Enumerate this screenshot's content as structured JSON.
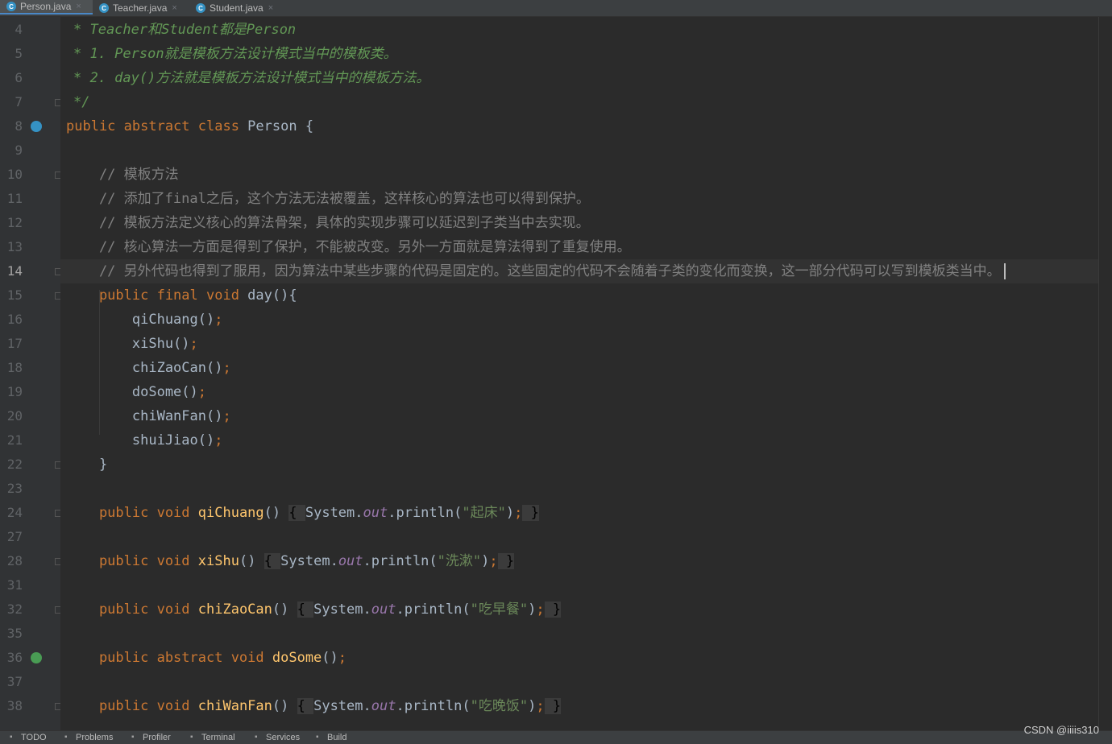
{
  "tabs": [
    {
      "label": "Person.java",
      "active": true,
      "icon": "class-icon"
    },
    {
      "label": "Teacher.java",
      "active": false,
      "icon": "class-icon"
    },
    {
      "label": "Student.java",
      "active": false,
      "icon": "class-icon"
    }
  ],
  "tab_icon_letter": "C",
  "lines": [
    {
      "num": "4",
      "parts": [
        [
          "doc",
          "* Teacher和Student都是Person"
        ]
      ]
    },
    {
      "num": "5",
      "parts": [
        [
          "doc",
          "* 1. Person就是模板方法设计模式当中的模板类。"
        ]
      ]
    },
    {
      "num": "6",
      "parts": [
        [
          "doc",
          "* 2. day()方法就是模板方法设计模式当中的模板方法。"
        ]
      ]
    },
    {
      "num": "7",
      "parts": [
        [
          "doc",
          "*/"
        ]
      ]
    },
    {
      "num": "8",
      "parts": [
        [
          "kw",
          "public abstract class "
        ],
        [
          "pl",
          "Person {"
        ]
      ]
    },
    {
      "num": "9",
      "parts": []
    },
    {
      "num": "10",
      "parts": [
        [
          "cm",
          "    // 模板方法"
        ]
      ]
    },
    {
      "num": "11",
      "parts": [
        [
          "cm",
          "    // 添加了final之后，这个方法无法被覆盖，这样核心的算法也可以得到保护。"
        ]
      ]
    },
    {
      "num": "12",
      "parts": [
        [
          "cm",
          "    // 模板方法定义核心的算法骨架，具体的实现步骤可以延迟到子类当中去实现。"
        ]
      ]
    },
    {
      "num": "13",
      "parts": [
        [
          "cm",
          "    // 核心算法一方面是得到了保护，不能被改变。另外一方面就是算法得到了重复使用。"
        ]
      ]
    },
    {
      "num": "14",
      "parts": [
        [
          "cm",
          "    // 另外代码也得到了服用，因为算法中某些步骤的代码是固定的。这些固定的代码不会随着子类的变化而变换，这一部分代码可以写到模板类当中。"
        ]
      ]
    },
    {
      "num": "15",
      "parts": [
        [
          "kw",
          "    public final void "
        ],
        [
          "pl",
          "day(){"
        ]
      ]
    },
    {
      "num": "16",
      "parts": [
        [
          "pl",
          "        qiChuang()"
        ],
        [
          "kw",
          ";"
        ]
      ]
    },
    {
      "num": "17",
      "parts": [
        [
          "pl",
          "        xiShu()"
        ],
        [
          "kw",
          ";"
        ]
      ]
    },
    {
      "num": "18",
      "parts": [
        [
          "pl",
          "        chiZaoCan()"
        ],
        [
          "kw",
          ";"
        ]
      ]
    },
    {
      "num": "19",
      "parts": [
        [
          "pl",
          "        doSome()"
        ],
        [
          "kw",
          ";"
        ]
      ]
    },
    {
      "num": "20",
      "parts": [
        [
          "pl",
          "        chiWanFan()"
        ],
        [
          "kw",
          ";"
        ]
      ]
    },
    {
      "num": "21",
      "parts": [
        [
          "pl",
          "        shuiJiao()"
        ],
        [
          "kw",
          ";"
        ]
      ]
    },
    {
      "num": "22",
      "parts": [
        [
          "pl",
          "    }"
        ]
      ]
    },
    {
      "num": "23",
      "parts": []
    },
    {
      "num": "24",
      "parts": [
        [
          "kw",
          "    public void "
        ],
        [
          "fn",
          "qiChuang"
        ],
        [
          "pl",
          "() "
        ],
        [
          "box",
          "{ "
        ],
        [
          "pl",
          "System."
        ],
        [
          "fld",
          "out"
        ],
        [
          "pl",
          ".println("
        ],
        [
          "str",
          "\"起床\""
        ],
        [
          "pl",
          ")"
        ],
        [
          "kw",
          ";"
        ],
        [
          "box",
          " }"
        ]
      ]
    },
    {
      "num": "27",
      "parts": []
    },
    {
      "num": "28",
      "parts": [
        [
          "kw",
          "    public void "
        ],
        [
          "fn",
          "xiShu"
        ],
        [
          "pl",
          "() "
        ],
        [
          "box",
          "{ "
        ],
        [
          "pl",
          "System."
        ],
        [
          "fld",
          "out"
        ],
        [
          "pl",
          ".println("
        ],
        [
          "str",
          "\"洗漱\""
        ],
        [
          "pl",
          ")"
        ],
        [
          "kw",
          ";"
        ],
        [
          "box",
          " }"
        ]
      ]
    },
    {
      "num": "31",
      "parts": []
    },
    {
      "num": "32",
      "parts": [
        [
          "kw",
          "    public void "
        ],
        [
          "fn",
          "chiZaoCan"
        ],
        [
          "pl",
          "() "
        ],
        [
          "box",
          "{ "
        ],
        [
          "pl",
          "System."
        ],
        [
          "fld",
          "out"
        ],
        [
          "pl",
          ".println("
        ],
        [
          "str",
          "\"吃早餐\""
        ],
        [
          "pl",
          ")"
        ],
        [
          "kw",
          ";"
        ],
        [
          "box",
          " }"
        ]
      ]
    },
    {
      "num": "35",
      "parts": []
    },
    {
      "num": "36",
      "parts": [
        [
          "kw",
          "    public abstract void "
        ],
        [
          "fn",
          "doSome"
        ],
        [
          "pl",
          "()"
        ],
        [
          "kw",
          ";"
        ]
      ]
    },
    {
      "num": "37",
      "parts": []
    },
    {
      "num": "38",
      "parts": [
        [
          "kw",
          "    public void "
        ],
        [
          "fn",
          "chiWanFan"
        ],
        [
          "pl",
          "() "
        ],
        [
          "box",
          "{ "
        ],
        [
          "pl",
          "System."
        ],
        [
          "fld",
          "out"
        ],
        [
          "pl",
          ".println("
        ],
        [
          "str",
          "\"吃晚饭\""
        ],
        [
          "pl",
          ")"
        ],
        [
          "kw",
          ";"
        ],
        [
          "box",
          " }"
        ]
      ]
    }
  ],
  "current_line": "14",
  "folds": [
    "7",
    "10",
    "14",
    "15",
    "22",
    "24",
    "28",
    "32",
    "38"
  ],
  "gutter_icons": [
    {
      "line": "8",
      "icon": "overridden-down-icon"
    },
    {
      "line": "36",
      "icon": "implemented-down-icon"
    }
  ],
  "statusbar": [
    {
      "label": "TODO",
      "icon": "list-icon"
    },
    {
      "label": "Problems",
      "icon": "problems-icon"
    },
    {
      "label": "Profiler",
      "icon": "profiler-icon"
    },
    {
      "label": "Terminal",
      "icon": "terminal-icon"
    },
    {
      "label": "Services",
      "icon": "services-icon"
    },
    {
      "label": "Build",
      "icon": "hammer-icon"
    }
  ],
  "watermark": "CSDN @iiiis310",
  "colors": {
    "background": "#2b2b2b",
    "keyword": "#cc7832",
    "comment": "#808080",
    "doc_comment": "#629755",
    "method": "#ffc66d",
    "string": "#6a8759",
    "field": "#9876aa"
  }
}
